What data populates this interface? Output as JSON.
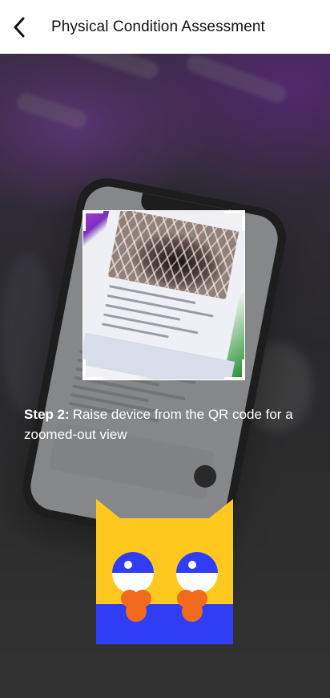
{
  "header": {
    "title": "Physical Condition Assessment",
    "back_icon": "chevron-left-icon"
  },
  "instruction": {
    "step_label": "Step 2:",
    "text": "Raise device from the QR code for a zoomed-out view"
  },
  "colors": {
    "owl_yellow": "#FFC81F",
    "owl_blue": "#2F3EF5",
    "owl_orange": "#F26A1B",
    "frame_white": "#FFFFFF"
  }
}
